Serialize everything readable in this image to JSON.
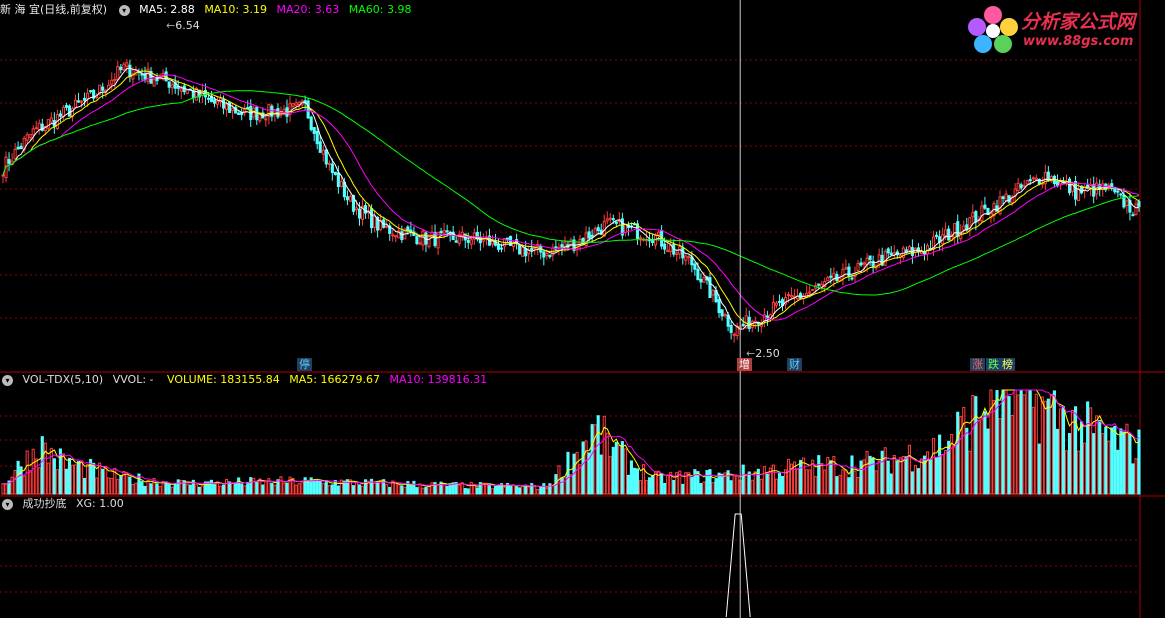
{
  "main_header": {
    "stock_name": "新 海 宜",
    "period": "(日线,前复权)",
    "ma5": "MA5: 2.88",
    "ma10": "MA10: 3.19",
    "ma20": "MA20: 3.63",
    "ma60": "MA60: 3.98"
  },
  "vol_header": {
    "indicator": "VOL-TDX(5,10)",
    "vvol": "VVOL: -",
    "volume": "VOLUME: 183155.84",
    "ma5": "MA5: 166279.67",
    "ma10": "MA10: 139816.31"
  },
  "xg_header": {
    "indicator": "成功抄底",
    "xg": "XG: 1.00"
  },
  "price_labels": {
    "high": "6.54",
    "low": "2.50"
  },
  "event_tags": [
    {
      "text": "停",
      "color": "#5fc8ff"
    },
    {
      "text": "增",
      "color": "#ffffff"
    },
    {
      "text": "财",
      "color": "#5fc8ff"
    },
    {
      "text": "涨",
      "color": "#ff6060"
    },
    {
      "text": "跌",
      "color": "#60ff60"
    },
    {
      "text": "榜",
      "color": "#ffff60"
    }
  ],
  "logo": {
    "title": "分析家公式网",
    "url": "www.88gs.com"
  },
  "colors": {
    "up": "#ff3c3c",
    "down": "#54ffff",
    "ma5": "#ffffff",
    "ma10": "#ffff00",
    "ma20": "#ff00ff",
    "ma60": "#00ff00",
    "grid": "#8b0000",
    "crosshair": "#cccccc"
  },
  "chart_data": [
    {
      "type": "candlestick",
      "title": "新 海 宜 (日线,前复权)",
      "ylim": [
        2.3,
        7.0
      ],
      "anchors": [
        [
          0,
          4.9
        ],
        [
          10,
          5.4
        ],
        [
          30,
          5.9
        ],
        [
          40,
          6.3
        ],
        [
          55,
          6.1
        ],
        [
          70,
          5.8
        ],
        [
          80,
          5.65
        ],
        [
          95,
          5.7
        ],
        [
          100,
          5.75
        ],
        [
          108,
          4.9
        ],
        [
          115,
          4.4
        ],
        [
          125,
          4.05
        ],
        [
          140,
          3.9
        ],
        [
          155,
          3.9
        ],
        [
          170,
          3.75
        ],
        [
          180,
          3.7
        ],
        [
          190,
          3.85
        ],
        [
          200,
          4.1
        ],
        [
          215,
          3.95
        ],
        [
          228,
          3.55
        ],
        [
          242,
          2.6
        ],
        [
          250,
          2.8
        ],
        [
          262,
          3.05
        ],
        [
          275,
          3.3
        ],
        [
          290,
          3.6
        ],
        [
          305,
          3.75
        ],
        [
          322,
          4.2
        ],
        [
          337,
          4.6
        ],
        [
          345,
          4.8
        ],
        [
          355,
          4.55
        ],
        [
          365,
          4.6
        ],
        [
          376,
          4.25
        ]
      ],
      "extremes": {
        "high": 6.54,
        "low": 2.5
      },
      "latest_ma": {
        "ma5": 2.88,
        "ma10": 3.19,
        "ma20": 3.63,
        "ma60": 3.98
      },
      "series": [
        {
          "name": "MA5"
        },
        {
          "name": "MA10"
        },
        {
          "name": "MA20"
        },
        {
          "name": "MA60"
        }
      ]
    },
    {
      "type": "bar",
      "title": "VOL-TDX(5,10)",
      "latest": {
        "volume": 183155.84,
        "ma5": 166279.67,
        "ma10": 139816.31
      },
      "anchors": [
        [
          0,
          0.1
        ],
        [
          12,
          0.45
        ],
        [
          20,
          0.3
        ],
        [
          40,
          0.15
        ],
        [
          60,
          0.1
        ],
        [
          100,
          0.12
        ],
        [
          150,
          0.08
        ],
        [
          180,
          0.07
        ],
        [
          196,
          0.6
        ],
        [
          205,
          0.35
        ],
        [
          215,
          0.15
        ],
        [
          240,
          0.18
        ],
        [
          262,
          0.25
        ],
        [
          290,
          0.3
        ],
        [
          310,
          0.45
        ],
        [
          322,
          0.75
        ],
        [
          330,
          1.0
        ],
        [
          340,
          0.9
        ],
        [
          360,
          0.6
        ],
        [
          376,
          0.45
        ]
      ],
      "series": [
        {
          "name": "MA5"
        },
        {
          "name": "MA10"
        }
      ]
    },
    {
      "type": "line",
      "title": "成功抄底",
      "signal_value": 1.0,
      "signal_index": 244
    }
  ]
}
